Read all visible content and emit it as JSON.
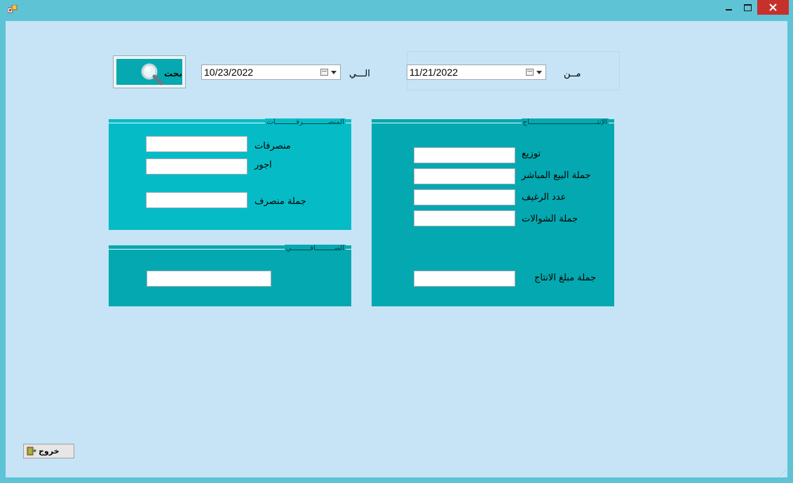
{
  "window": {
    "title": ""
  },
  "date_range": {
    "from_label": "مــن",
    "from_value": "11/21/2022",
    "to_label": "الـــي",
    "to_value": "10/23/2022"
  },
  "search_button": {
    "label": "بحث",
    "icon": "magnifier-icon"
  },
  "production_group": {
    "title": "الإنتـــــــــــــــــــــــــــــــــاج",
    "fields": [
      {
        "label": "توزيع",
        "value": ""
      },
      {
        "label": "جملة البيع المباشر",
        "value": ""
      },
      {
        "label": "عدد الرغيف",
        "value": ""
      },
      {
        "label": "جملة الشوالات",
        "value": ""
      }
    ],
    "total_label": "جملة مبلغ الانتاج",
    "total_value": ""
  },
  "expenses_group": {
    "title": "المنصــــــــــــرفــــــــــات",
    "fields": [
      {
        "label": "منصرفات",
        "value": ""
      },
      {
        "label": "اجور",
        "value": ""
      }
    ],
    "total_label": "جملة منصرف",
    "total_value": ""
  },
  "net_group": {
    "title": "الصـــــــــافـــــــــي",
    "value": ""
  },
  "exit_button": {
    "label": "خروج",
    "icon": "exit-door-icon"
  },
  "colors": {
    "frame": "#5fc3d6",
    "client": "#c6e4f5",
    "panel_light": "#05bcc6",
    "panel_dark": "#04a8b0",
    "close": "#c7312b"
  }
}
